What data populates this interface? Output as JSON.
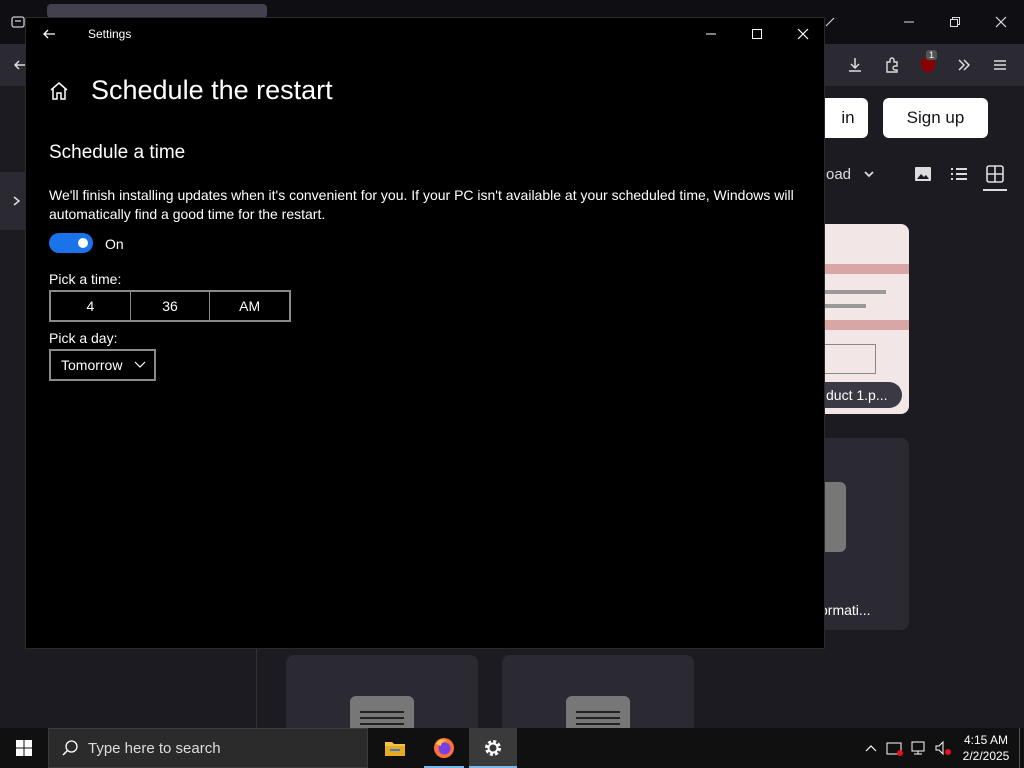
{
  "browser": {
    "login_label": "in",
    "signup_label": "Sign up",
    "download_label": "oad",
    "extension_badge": "1",
    "cards": [
      {
        "label": "duct 1.p..."
      },
      {
        "label": "ormati..."
      }
    ]
  },
  "settings": {
    "window_title": "Settings",
    "page_title": "Schedule the restart",
    "section_title": "Schedule a time",
    "description": "We'll finish installing updates when it's convenient for you. If your PC isn't available at your scheduled time, Windows will automatically find a good time for the restart.",
    "toggle": {
      "state": true,
      "label": "On"
    },
    "pick_time_label": "Pick a time:",
    "time": {
      "hour": "4",
      "minute": "36",
      "period": "AM"
    },
    "pick_day_label": "Pick a day:",
    "day": "Tomorrow"
  },
  "taskbar": {
    "search_placeholder": "Type here to search",
    "clock_time": "4:15 AM",
    "clock_date": "2/2/2025"
  },
  "colors": {
    "accent": "#1a73e8",
    "settings_bg": "#000000",
    "browser_bg": "#1c1b22"
  }
}
